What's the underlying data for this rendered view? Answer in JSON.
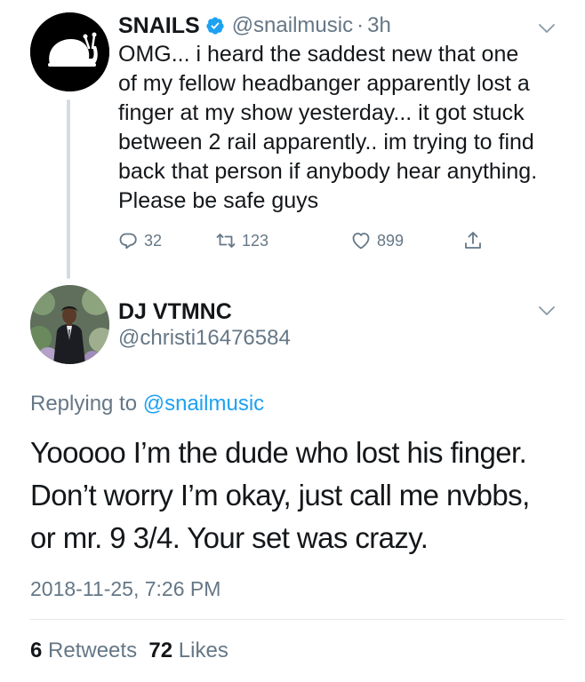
{
  "colors": {
    "text_primary": "#14171a",
    "text_secondary": "#657786",
    "link": "#1da1f2",
    "verified": "#1da1f2",
    "thread_line": "#d3dbe3",
    "divider": "#e1e8ed"
  },
  "tweet1": {
    "author_name": "SNAILS",
    "verified_icon": "verified-badge-icon",
    "handle": "@snailmusic",
    "separator": "·",
    "time": "3h",
    "menu_icon": "chevron-down-icon",
    "text": "OMG... i heard the saddest new that one\nof my fellow headbanger apparently lost a\nfinger at my show yesterday... it got stuck\nbetween 2 rail apparently.. im trying to find\nback that person if anybody hear anything.\nPlease be safe guys",
    "actions": {
      "reply": {
        "icon": "reply-icon",
        "count": "32"
      },
      "retweet": {
        "icon": "retweet-icon",
        "count": "123"
      },
      "like": {
        "icon": "heart-icon",
        "count": "899"
      },
      "share": {
        "icon": "share-icon"
      }
    }
  },
  "tweet2": {
    "author_name": "DJ VTMNC",
    "handle": "@christi16476584",
    "menu_icon": "chevron-down-icon",
    "replying_prefix": "Replying to ",
    "replying_to": "@snailmusic",
    "text": "Yooooo I’m the dude who lost his finger.\nDon’t worry I’m okay, just call me nvbbs,\nor mr. 9 3/4. Your set was crazy.",
    "timestamp": "2018-11-25, 7:26 PM",
    "stats": {
      "retweets_count": "6",
      "retweets_label": "Retweets",
      "likes_count": "72",
      "likes_label": "Likes"
    }
  }
}
